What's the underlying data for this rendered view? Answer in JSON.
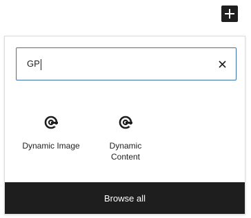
{
  "toolbar": {
    "add_icon": "plus-icon"
  },
  "search": {
    "value": "GP",
    "clear_icon": "close-icon"
  },
  "results": [
    {
      "label": "Dynamic Image",
      "icon": "generateblocks-icon"
    },
    {
      "label": "Dynamic Content",
      "icon": "generateblocks-icon"
    }
  ],
  "footer": {
    "browse_all_label": "Browse all"
  },
  "colors": {
    "accent": "#3a73a9",
    "dark": "#1e1e1e"
  }
}
